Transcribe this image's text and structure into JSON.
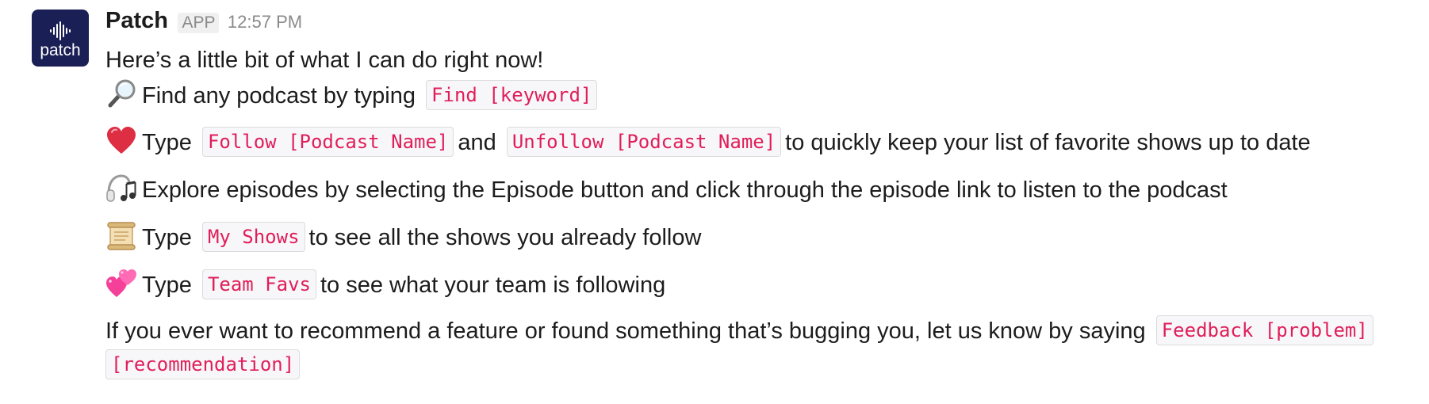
{
  "avatar": {
    "wordmark": "patch",
    "background": "#1a1f55"
  },
  "header": {
    "sender": "Patch",
    "badge": "APP",
    "time": "12:57 PM"
  },
  "intro": "Here’s a little bit of what I can do right now!",
  "items": [
    {
      "icon": "magnifying-glass-icon",
      "text1": "Find any podcast by typing",
      "code1": "Find [keyword]"
    },
    {
      "icon": "red-heart-icon",
      "text1": "Type",
      "code1": "Follow [Podcast Name]",
      "text2": "and",
      "code2": "Unfollow [Podcast Name]",
      "text3": "to quickly keep your list of favorite shows up to date"
    },
    {
      "icon": "headphones-music-icon",
      "text1": "Explore episodes by selecting the Episode button and click through the episode link to listen to the podcast"
    },
    {
      "icon": "scroll-icon",
      "text1": "Type",
      "code1": "My Shows",
      "text2": "to see all the shows you already follow"
    },
    {
      "icon": "two-hearts-icon",
      "text1": "Type",
      "code1": "Team Favs",
      "text2": "to see what your team is following"
    }
  ],
  "footer": {
    "text": "If you ever want to recommend a feature or found something that’s bugging you, let us know by saying",
    "code_part1": "Feedback [problem]",
    "code_part2": "[recommendation]"
  },
  "colors": {
    "code_text": "#e01e5a",
    "code_bg": "#f7f7f9",
    "text": "#1d1c1d",
    "muted": "#8a8a8a"
  }
}
